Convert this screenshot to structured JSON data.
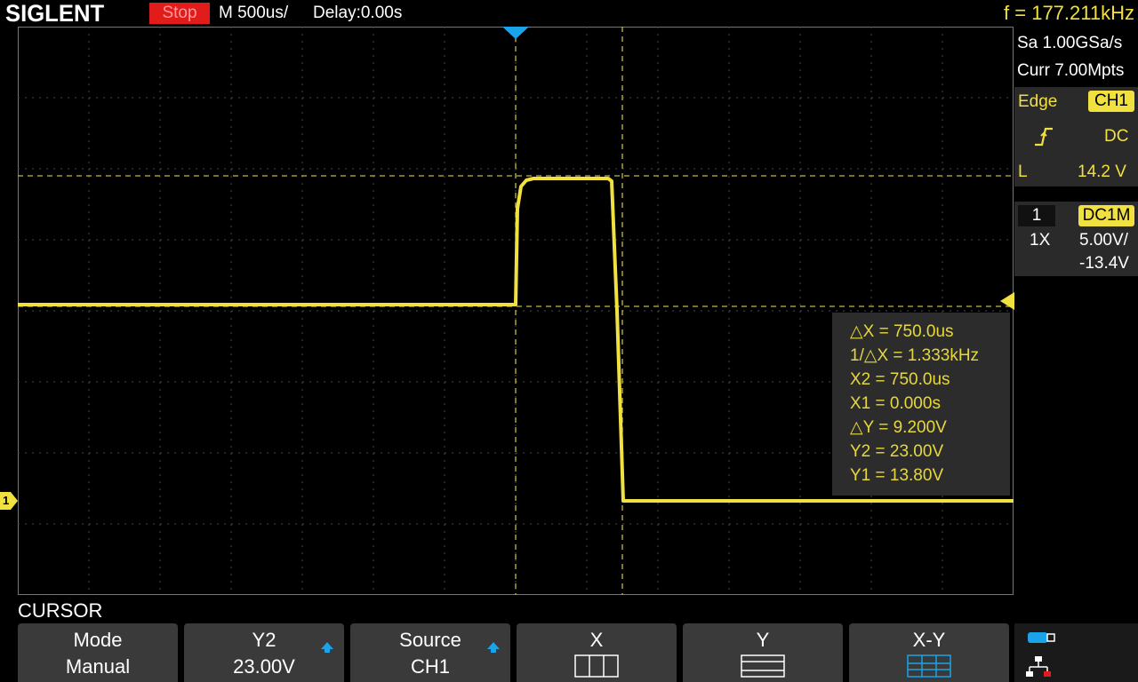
{
  "header": {
    "brand": "SIGLENT",
    "run_status": "Stop",
    "timebase": "M 500us/",
    "delay": "Delay:0.00s",
    "frequency": "f = 177.211kHz"
  },
  "acquisition": {
    "sample_rate": "Sa 1.00GSa/s",
    "memory_depth": "Curr 7.00Mpts"
  },
  "trigger": {
    "type": "Edge",
    "source": "CH1",
    "slope_icon": "rising-edge-icon",
    "coupling": "DC",
    "level_label": "L",
    "level": "14.2 V"
  },
  "channel": {
    "number": "1",
    "coupling": "DC1M",
    "probe": "1X",
    "scale": "5.00V/",
    "offset": "-13.4V",
    "marker_label": "1"
  },
  "cursor_measurements": [
    "△X = 750.0us",
    "1/△X = 1.333kHz",
    "X2 = 750.0us",
    "X1 = 0.000s",
    "△Y = 9.200V",
    "Y2 = 23.00V",
    "Y1 = 13.80V"
  ],
  "menu": {
    "title": "CURSOR",
    "softkeys": [
      {
        "line1": "Mode",
        "line2": "Manual"
      },
      {
        "line1": "Y2",
        "line2": "23.00V"
      },
      {
        "line1": "Source",
        "line2": "CH1"
      },
      {
        "line1": "X",
        "line2": ""
      },
      {
        "line1": "Y",
        "line2": ""
      },
      {
        "line1": "X-Y",
        "line2": ""
      }
    ]
  },
  "colors": {
    "trace": "#f0e040",
    "run_stop": "#e21b1b",
    "accent_blue": "#1aa3e8",
    "grid": "#555555"
  },
  "icons": [
    "rising-edge-icon",
    "up-arrow-icon",
    "cursor-x-icon",
    "cursor-y-icon",
    "cursor-xy-icon",
    "usb-icon",
    "network-icon"
  ]
}
